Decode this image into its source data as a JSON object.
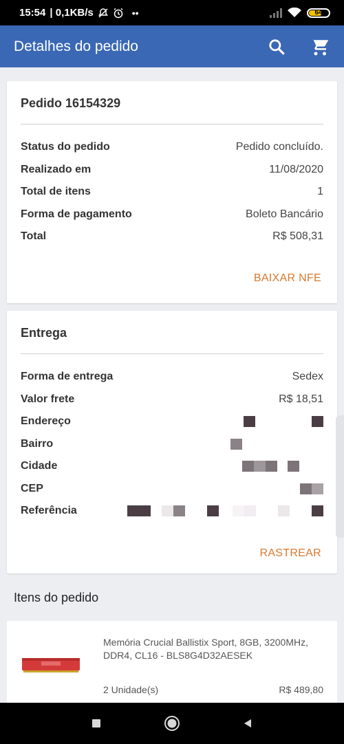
{
  "status_bar": {
    "time": "15:54",
    "network_speed": "| 0,1KB/s",
    "battery_level": "64"
  },
  "app_bar": {
    "title": "Detalhes do pedido",
    "icons": [
      "search-icon",
      "cart-icon"
    ],
    "color": "#3a68b4"
  },
  "order": {
    "title": "Pedido 16154329",
    "rows": [
      {
        "label": "Status do pedido",
        "value": "Pedido concluído."
      },
      {
        "label": "Realizado em",
        "value": "11/08/2020"
      },
      {
        "label": "Total de itens",
        "value": "1"
      },
      {
        "label": "Forma de pagamento",
        "value": "Boleto Bancário"
      },
      {
        "label": "Total",
        "value": "R$ 508,31"
      }
    ],
    "action_label": "BAIXAR NFE"
  },
  "delivery": {
    "title": "Entrega",
    "rows": [
      {
        "label": "Forma de entrega",
        "value": "Sedex"
      },
      {
        "label": "Valor frete",
        "value": "R$ 18,51"
      },
      {
        "label": "Endereço",
        "value": ""
      },
      {
        "label": "Bairro",
        "value": ""
      },
      {
        "label": "Cidade",
        "value": ""
      },
      {
        "label": "CEP",
        "value": ""
      },
      {
        "label": "Referência",
        "value": ""
      }
    ],
    "action_label": "RASTREAR"
  },
  "items_section": {
    "title": "Itens do pedido",
    "items": [
      {
        "name": "Memória Crucial Ballistix Sport, 8GB, 3200MHz, DDR4, CL16 - BLS8G4D32AESEK",
        "quantity": "2 Unidade(s)",
        "price": "R$ 489,80",
        "thumb_color": "#d43a3a"
      }
    ]
  },
  "colors": {
    "accent": "#d9782d",
    "app_bar": "#3a68b4",
    "background": "#eceef2"
  }
}
